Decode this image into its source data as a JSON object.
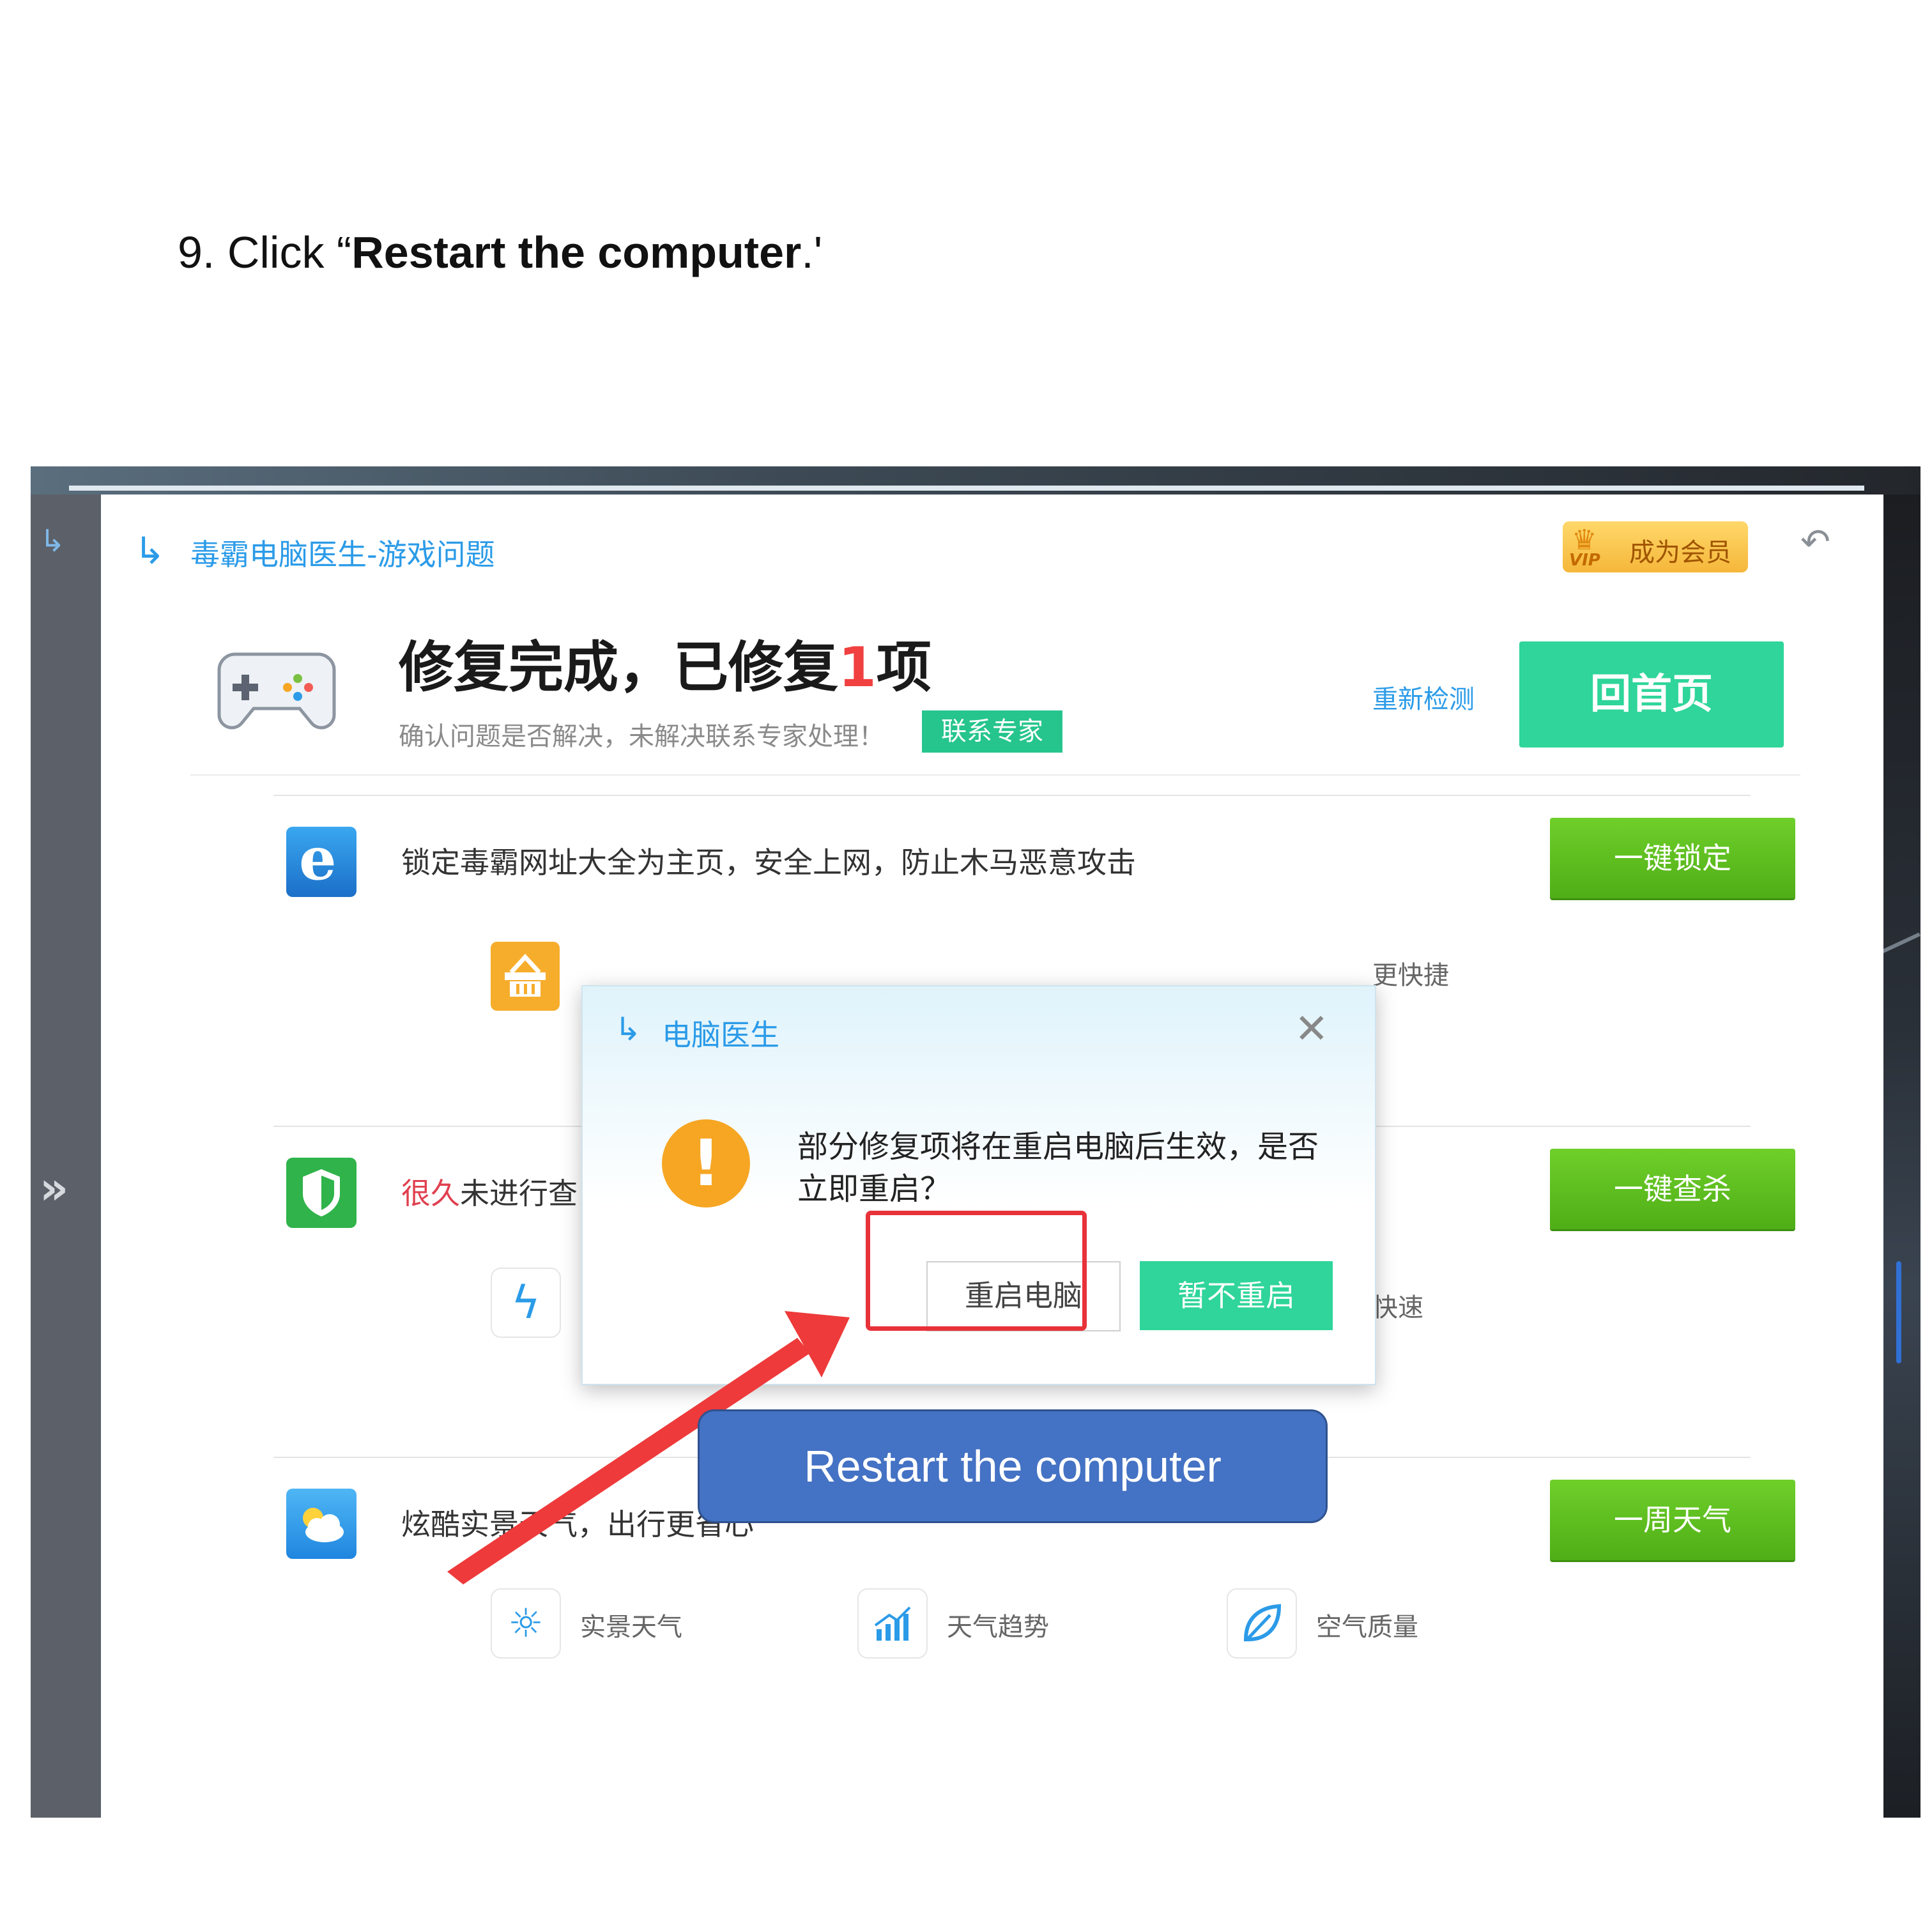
{
  "instruction": {
    "prefix": "9. Click “",
    "bold": "Restart the computer",
    "suffix": ".'"
  },
  "app": {
    "title": "毒霸电脑医生-游戏问题",
    "vip_label": "成为会员",
    "vip_tag": "VIP"
  },
  "hero": {
    "headline_a": "修复完成，已修复",
    "headline_num": "1",
    "headline_b": "项",
    "subtitle": "确认问题是否解决，未解决联系专家处理！",
    "expert_button": "联系专家",
    "recheck_link": "重新检测",
    "home_button": "回首页"
  },
  "rows": [
    {
      "text": "锁定毒霸网址大全为主页，安全上网，防止木马恶意攻击",
      "button": "一键锁定",
      "peek": "更快捷"
    },
    {
      "text_red": "很久",
      "text": "未进行查",
      "button": "一键查杀",
      "peek": "快速"
    },
    {
      "text": "炫酷实景天气，出行更省心",
      "button": "一周天气"
    }
  ],
  "weather_items": [
    "实景天气",
    "天气趋势",
    "空气质量"
  ],
  "dialog": {
    "title": "电脑医生",
    "message": "部分修复项将在重启电脑后生效，是否立即重启？",
    "restart_button": "重启电脑",
    "later_button": "暂不重启"
  },
  "callout": "Restart the computer",
  "colors": {
    "accent_blue": "#2b9be8",
    "teal_button": "#2fd59a",
    "green_button": "#4fae16",
    "highlight_red": "#e8323a",
    "callout_blue": "#4472c4"
  },
  "icons": {
    "app_logo": "stethoscope-icon",
    "back": "undo-icon",
    "close": "close-icon",
    "warning": "warning-icon"
  }
}
